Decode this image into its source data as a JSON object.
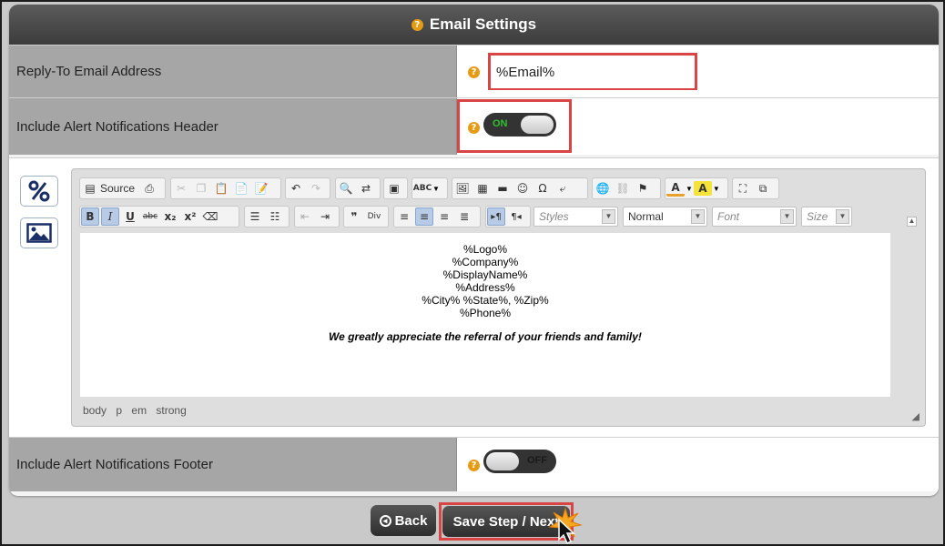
{
  "header": {
    "title": "Email Settings"
  },
  "reply_to": {
    "label": "Reply-To Email Address",
    "value": "%Email%"
  },
  "alert_header": {
    "label": "Include Alert Notifications Header",
    "state": "ON"
  },
  "alert_footer": {
    "label": "Include Alert Notifications Footer",
    "state": "OFF"
  },
  "editor": {
    "source_label": "Source",
    "styles_combo": "Styles",
    "format_combo": "Normal",
    "font_combo": "Font",
    "size_combo": "Size",
    "content_lines": [
      "%Logo%",
      "%Company%",
      "%DisplayName%",
      "%Address%",
      "%City% %State%, %Zip%",
      "%Phone%"
    ],
    "tagline": "We greatly appreciate the referral of your friends and family!",
    "element_path": [
      "body",
      "p",
      "em",
      "strong"
    ]
  },
  "buttons": {
    "back": "Back",
    "next": "Save Step / Next"
  },
  "colors": {
    "accent_red": "#d94545",
    "help_icon": "#e69b13",
    "toggle_on_text": "#2fbf2f"
  },
  "icons": [
    "help-icon",
    "percent-icon",
    "image-icon",
    "back-arrow-icon",
    "cursor-icon"
  ]
}
